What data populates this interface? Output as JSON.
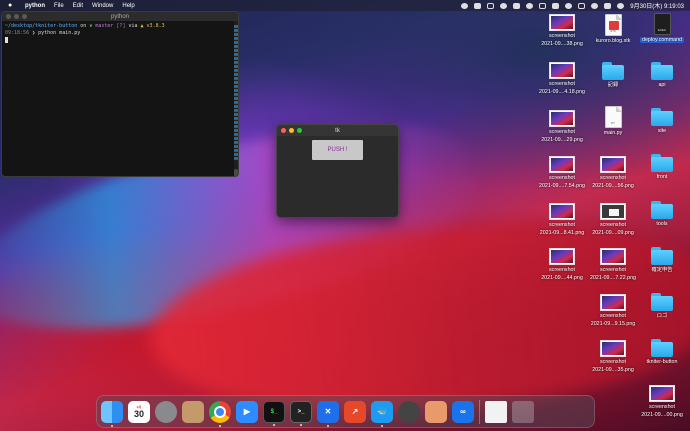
{
  "menubar": {
    "app_name": "python",
    "menus": [
      "File",
      "Edit",
      "Window",
      "Help"
    ],
    "clock": "9月30日(木)  9:19:03"
  },
  "terminal": {
    "title": "python",
    "line1_path": "~/desktop/tkniter-button",
    "line1_on": "on",
    "line1_branch": "master",
    "line1_flags": "[?]",
    "line1_via": "via",
    "line1_version": "v3.8.3",
    "line2_time": "09:18:56",
    "line2_cmd": "❯ python main.py"
  },
  "tk_window": {
    "title": "tk",
    "button_label": "PUSH !"
  },
  "desktop": {
    "col1": [
      {
        "label1": "screenshot",
        "label2": "2021-09....38.png",
        "type": "shot"
      },
      {
        "label1": "screenshot",
        "label2": "2021-09....4.18.png",
        "type": "shot"
      },
      {
        "label1": "screenshot",
        "label2": "2021-09....29.png",
        "type": "shot"
      },
      {
        "label1": "screenshot",
        "label2": "2021-09....7.54.png",
        "type": "shot"
      },
      {
        "label1": "screenshot",
        "label2": "2021-09...8.41.png",
        "type": "shot"
      },
      {
        "label1": "screenshot",
        "label2": "2021-09....44.png",
        "type": "shot"
      }
    ],
    "col2": [
      {
        "label1": "kuroro.blog.stk",
        "label2": "",
        "type": "doc"
      },
      {
        "label1": "記録",
        "label2": "",
        "type": "folder"
      },
      {
        "label1": "main.py",
        "label2": "",
        "type": "doc"
      },
      {
        "label1": "screenshot",
        "label2": "2021-09....56.png",
        "type": "shot"
      },
      {
        "label1": "screenshot",
        "label2": "2021-09....09.png",
        "type": "shot"
      },
      {
        "label1": "screenshot",
        "label2": "2021-09....7.22.png",
        "type": "shot"
      },
      {
        "label1": "screenshot",
        "label2": "2021-09...9.15.png",
        "type": "shot"
      },
      {
        "label1": "screenshot",
        "label2": "2021-09....35.png",
        "type": "shot"
      }
    ],
    "col3": [
      {
        "label1": "deploy.command",
        "label2": "",
        "type": "exec"
      },
      {
        "label1": "api",
        "label2": "",
        "type": "folder"
      },
      {
        "label1": "site",
        "label2": "",
        "type": "folder"
      },
      {
        "label1": "front",
        "label2": "",
        "type": "folder"
      },
      {
        "label1": "tools",
        "label2": "",
        "type": "folder"
      },
      {
        "label1": "確定申告",
        "label2": "",
        "type": "folder"
      },
      {
        "label1": "ロゴ",
        "label2": "",
        "type": "folder"
      },
      {
        "label1": "tkniter-button",
        "label2": "",
        "type": "folder"
      },
      {
        "label1": "screenshot",
        "label2": "2021-09....00.png",
        "type": "shot"
      }
    ],
    "doc_tags": {
      "stk": "STK",
      "py": "PY",
      "exec": "EXEC"
    }
  },
  "dock": {
    "calendar_month": "9月",
    "calendar_day": "30",
    "iterm_glyph": "$_",
    "terminal_glyph": ">_",
    "vscode_glyph": "✕",
    "fork_glyph": "↗",
    "docker_glyph": "🐳",
    "infinity_glyph": "∞",
    "zoom_glyph": "▶"
  },
  "colors": {
    "accent_blue": "#2a62d8",
    "folder_blue": "#39b5ef",
    "button_text": "#8a2aa0"
  }
}
